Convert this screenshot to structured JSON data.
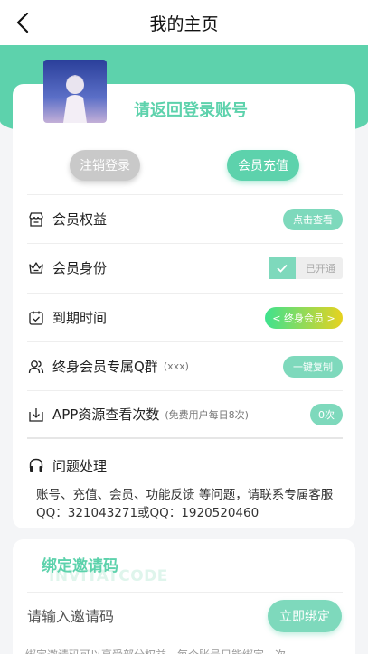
{
  "header": {
    "title": "我的主页"
  },
  "profile": {
    "login_prompt": "请返回登录账号",
    "logout_label": "注销登录",
    "recharge_label": "会员充值"
  },
  "rows": [
    {
      "label": "会员权益",
      "hint": "",
      "action": "点击查看"
    },
    {
      "label": "会员身份",
      "hint": "",
      "action": "已开通"
    },
    {
      "label": "到期时间",
      "hint": "",
      "action": "< 终身会员 >"
    },
    {
      "label": "终身会员专属Q群",
      "hint": "(xxx)",
      "action": "一键复制"
    },
    {
      "label": "APP资源查看次数",
      "hint": "(免费用户每日8次)",
      "action": "0次"
    },
    {
      "label": "问题处理",
      "hint": "",
      "action": ""
    }
  ],
  "problem": {
    "text": "账号、充值、会员、功能反馈 等问题，请联系专属客服 QQ：321043271或QQ：1920520460"
  },
  "invite": {
    "title": "绑定邀请码",
    "watermark": "INVITATCODE",
    "placeholder": "请输入邀请码",
    "bind_label": "立即绑定",
    "note": "绑定邀请码可以享受部分权益，每个账号只能绑定一次"
  },
  "colors": {
    "accent": "#5dd2ac",
    "accent_light": "#7ed9bc",
    "disabled": "#c9c9c9"
  }
}
